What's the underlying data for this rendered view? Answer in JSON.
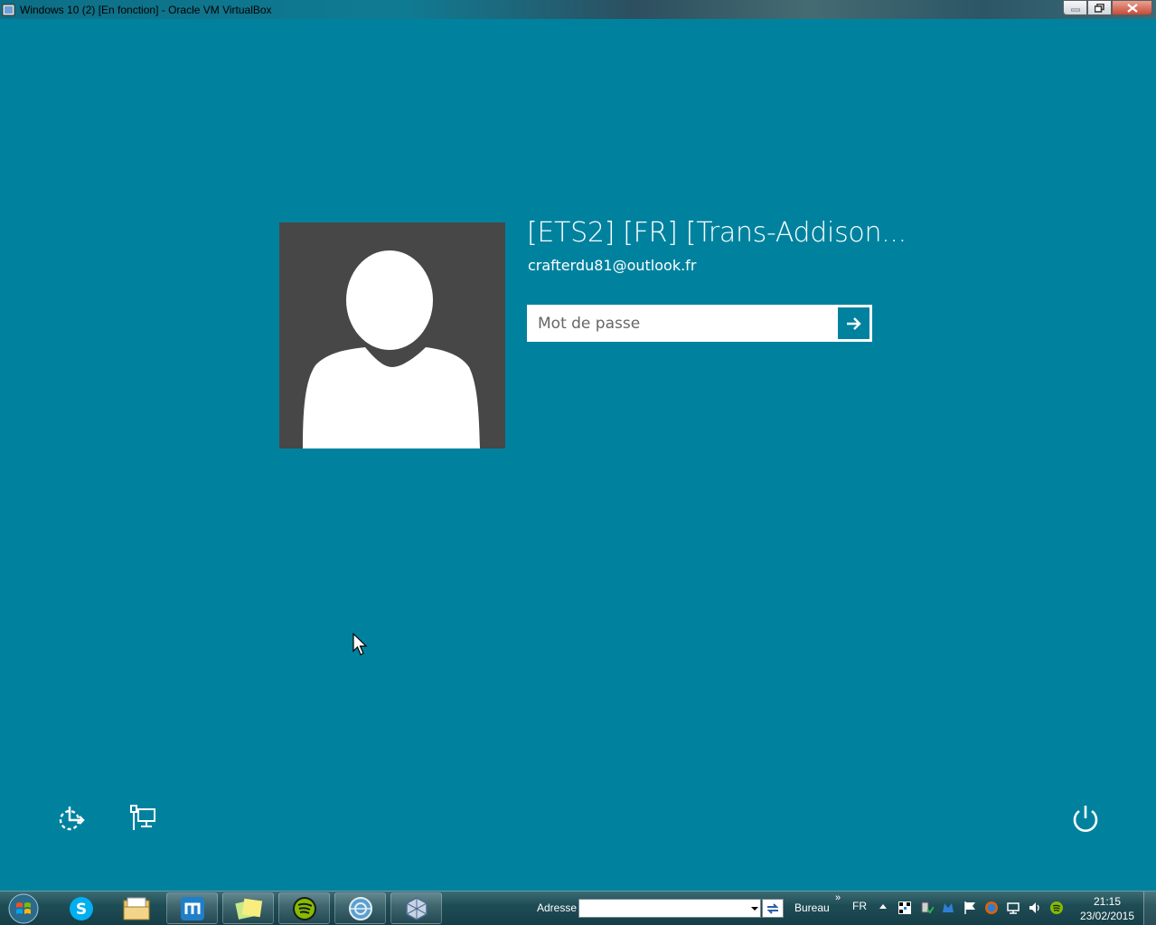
{
  "window": {
    "title": "Windows 10 (2) [En fonction] - Oracle VM VirtualBox"
  },
  "login": {
    "user_name": "[ETS2] [FR] [Trans-Addison...",
    "email": "crafterdu81@outlook.fr",
    "password_placeholder": "Mot de passe"
  },
  "taskbar": {
    "address_label": "Adresse",
    "desktop_label": "Bureau",
    "overflow_chevrons": "»",
    "language": "FR",
    "time": "21:15",
    "date": "23/02/2015",
    "pinned_apps": [
      "start-orb",
      "skype",
      "file-explorer",
      "maxthon",
      "sticky-notes",
      "spotify",
      "network-globe",
      "virtualbox"
    ]
  },
  "colors": {
    "background": "#00829f",
    "avatar_tile": "#474747",
    "text": "#ffffff"
  }
}
